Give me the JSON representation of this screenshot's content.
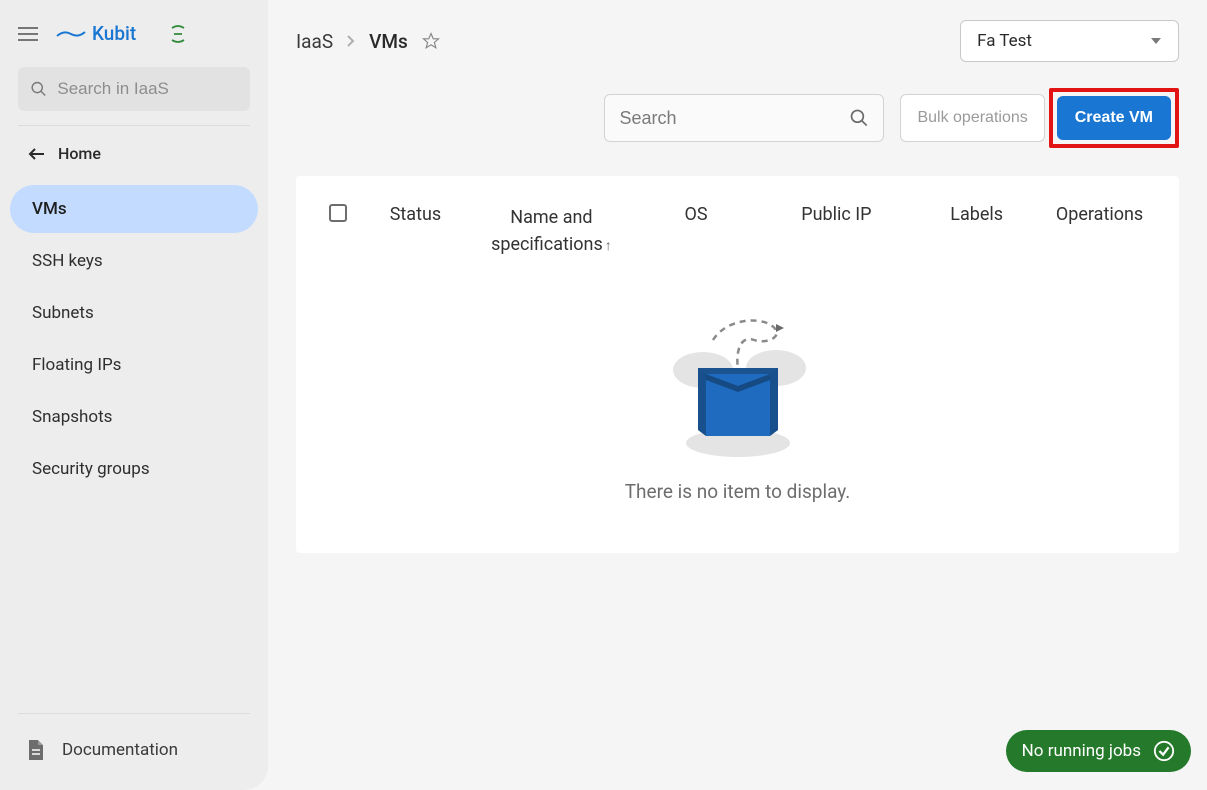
{
  "brand": {
    "name": "Kubit"
  },
  "sidebar": {
    "search_placeholder": "Search in IaaS",
    "home_label": "Home",
    "items": [
      {
        "label": "VMs",
        "active": true
      },
      {
        "label": "SSH keys",
        "active": false
      },
      {
        "label": "Subnets",
        "active": false
      },
      {
        "label": "Floating IPs",
        "active": false
      },
      {
        "label": "Snapshots",
        "active": false
      },
      {
        "label": "Security groups",
        "active": false
      }
    ],
    "documentation_label": "Documentation"
  },
  "breadcrumb": {
    "root": "IaaS",
    "current": "VMs"
  },
  "project_selector": {
    "value": "Fa Test"
  },
  "actions": {
    "search_placeholder": "Search",
    "bulk_label": "Bulk operations",
    "create_label": "Create VM"
  },
  "table": {
    "columns": {
      "status": "Status",
      "name": "Name and specifications",
      "os": "OS",
      "public_ip": "Public IP",
      "labels": "Labels",
      "operations": "Operations"
    },
    "empty_message": "There is no item to display."
  },
  "jobs_pill": {
    "label": "No running jobs"
  }
}
